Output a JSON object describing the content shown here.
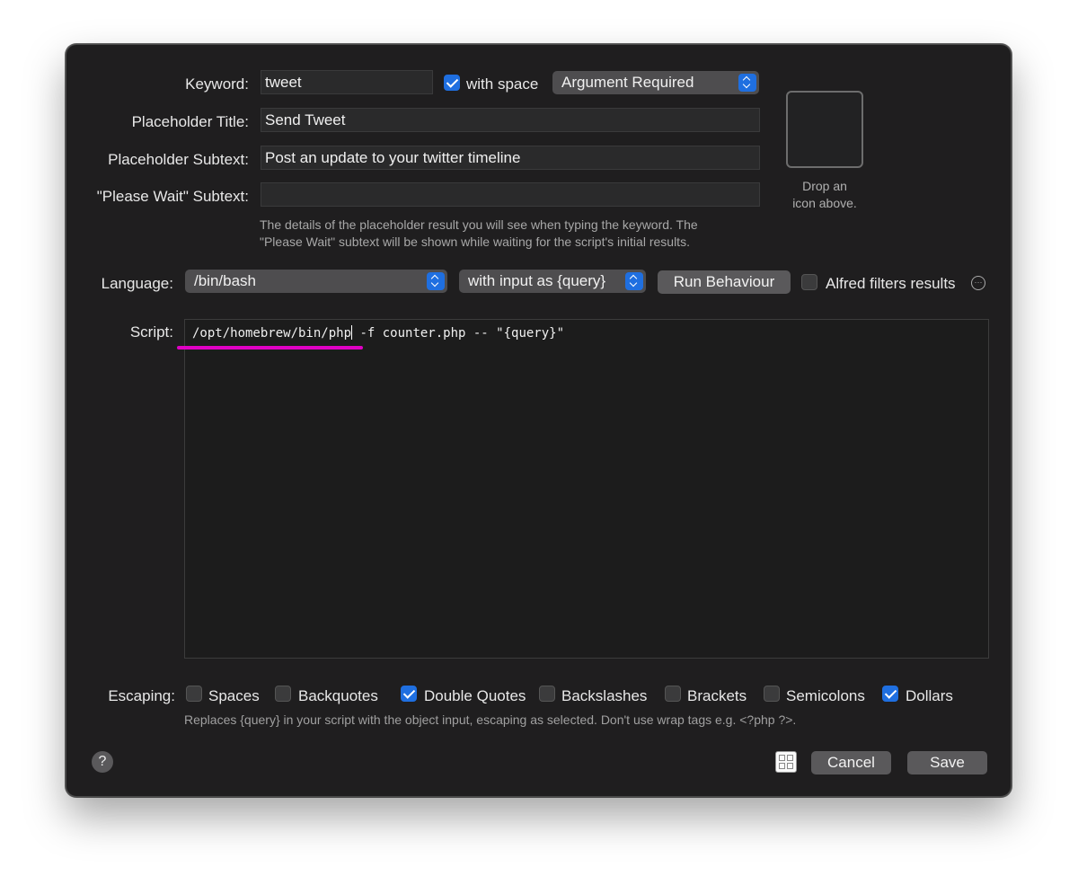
{
  "form": {
    "keyword_label": "Keyword:",
    "keyword_value": "tweet",
    "with_space_label": "with space",
    "with_space_checked": true,
    "argument_option": "Argument Required",
    "placeholder_title_label": "Placeholder Title:",
    "placeholder_title_value": "Send Tweet",
    "placeholder_subtext_label": "Placeholder Subtext:",
    "placeholder_subtext_value": "Post an update to your twitter timeline",
    "please_wait_label": "\"Please Wait\" Subtext:",
    "please_wait_value": "",
    "hint_line1": "The details of the placeholder result you will see when typing the keyword. The",
    "hint_line2": "\"Please Wait\" subtext will be shown while waiting for the script's initial results."
  },
  "icon_drop": {
    "line1": "Drop an",
    "line2": "icon above."
  },
  "language": {
    "label": "Language:",
    "value": "/bin/bash",
    "input_mode": "with input as {query}",
    "run_behaviour_label": "Run Behaviour",
    "alfred_filters_label": "Alfred filters results",
    "alfred_filters_checked": false,
    "info_icon": "ellipsis-circle-icon"
  },
  "script": {
    "label": "Script:",
    "part1": "/opt/homebrew/bin/php",
    "part2": " -f counter.php -- \"{query}\"",
    "highlight_color": "#e000c4"
  },
  "escaping": {
    "label": "Escaping:",
    "options": [
      {
        "label": "Spaces",
        "checked": false
      },
      {
        "label": "Backquotes",
        "checked": false
      },
      {
        "label": "Double Quotes",
        "checked": true
      },
      {
        "label": "Backslashes",
        "checked": false
      },
      {
        "label": "Brackets",
        "checked": false
      },
      {
        "label": "Semicolons",
        "checked": false
      },
      {
        "label": "Dollars",
        "checked": true
      }
    ],
    "hint": "Replaces {query} in your script with the object input, escaping as selected. Don't use wrap tags e.g. <?php ?>."
  },
  "footer": {
    "help_label": "?",
    "cancel_label": "Cancel",
    "save_label": "Save",
    "grid_icon": "grid-icon"
  },
  "colors": {
    "accent": "#1f6fe0",
    "window_bg": "#1f1e1f"
  }
}
